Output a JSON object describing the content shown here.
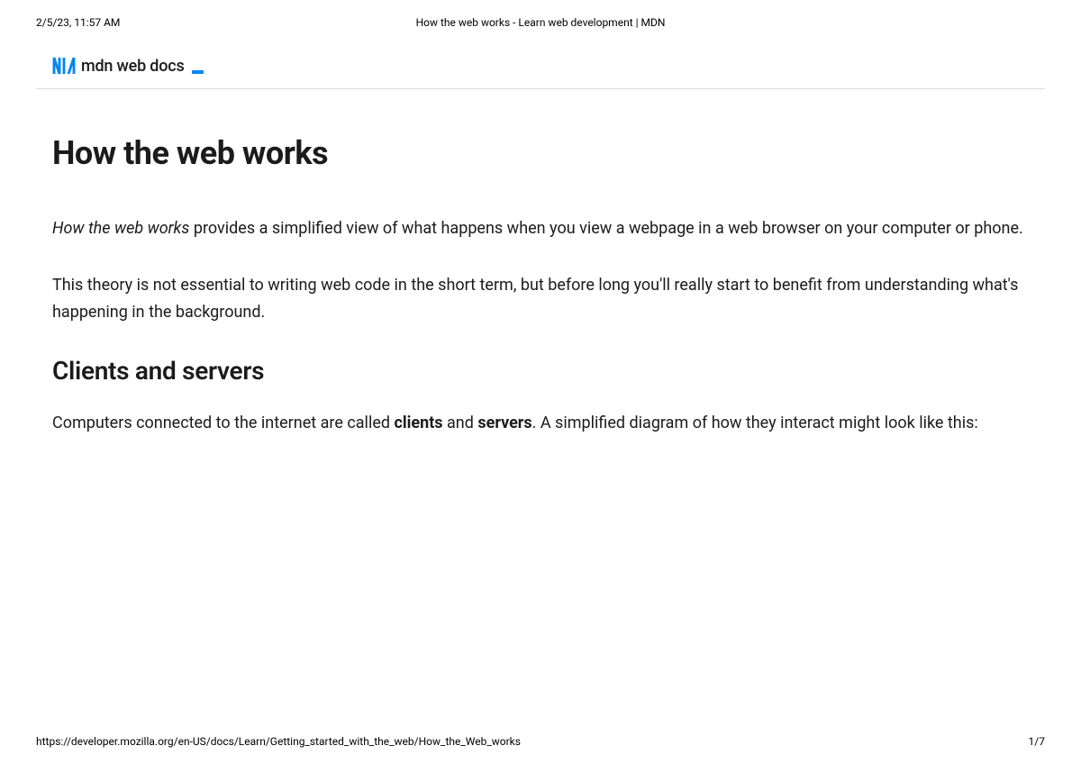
{
  "print": {
    "timestamp": "2/5/23, 11:57 AM",
    "title": "How the web works - Learn web development | MDN",
    "url": "https://developer.mozilla.org/en-US/docs/Learn/Getting_started_with_the_web/How_the_Web_works",
    "page": "1/7"
  },
  "logo": {
    "text": "mdn web docs"
  },
  "article": {
    "title": "How the web works",
    "intro1_em": "How the web works",
    "intro1_rest": " provides a simplified view of what happens when you view a webpage in a web browser on your computer or phone.",
    "intro2": "This theory is not essential to writing web code in the short term, but before long you'll really start to benefit from understanding what's happening in the background.",
    "section1_heading": "Clients and servers",
    "section1_p_pre": "Computers connected to the internet are called ",
    "section1_p_bold1": "clients",
    "section1_p_mid": " and ",
    "section1_p_bold2": "servers",
    "section1_p_post": ". A simplified diagram of how they interact might look like this:"
  }
}
